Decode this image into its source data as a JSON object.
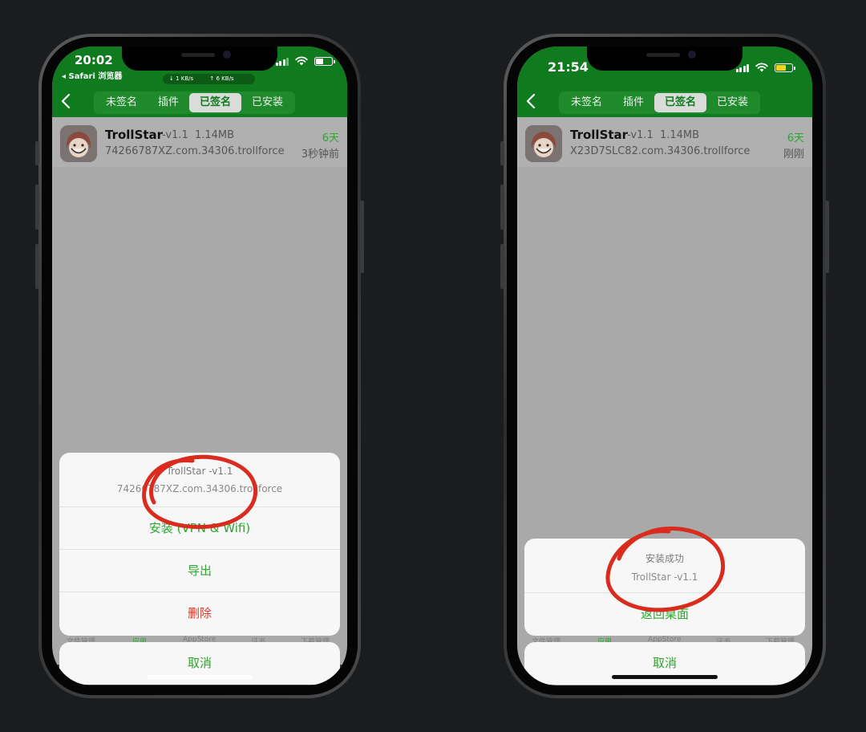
{
  "colors": {
    "brand_green": "#0f7a1e",
    "accent_green": "#2ca82c",
    "danger_red": "#e03a2c",
    "scribble_red": "#d92c1f"
  },
  "tabs": [
    "未签名",
    "插件",
    "已签名",
    "已安装"
  ],
  "active_tab": "已签名",
  "tabbar": [
    "文件管理",
    "应用",
    "AppStore",
    "证书",
    "下载管理"
  ],
  "left": {
    "time": "20:02",
    "back_app": "◂ Safari 浏览器",
    "net_down": "↓ 1 KB/s",
    "net_up": "↑ 6 KB/s",
    "app": {
      "name": "TrollStar",
      "version": "-v1.1",
      "size": "1.14MB",
      "bundle": "74266787XZ.com.34306.trollforce",
      "days": "6天",
      "time": "3秒钟前"
    },
    "sheet": {
      "title": "TrollStar -v1.1",
      "subtitle": "74266787XZ.com.34306.trollforce",
      "install": "安装 (VPN & Wifi)",
      "export": "导出",
      "delete": "删除"
    },
    "cancel": "取消"
  },
  "right": {
    "time": "21:54",
    "app": {
      "name": "TrollStar",
      "version": "-v1.1",
      "size": "1.14MB",
      "bundle": "X23D7SLC82.com.34306.trollforce",
      "days": "6天",
      "time": "刚刚"
    },
    "sheet": {
      "title": "安装成功",
      "subtitle": "TrollStar -v1.1",
      "home": "返回桌面"
    },
    "cancel": "取消"
  }
}
